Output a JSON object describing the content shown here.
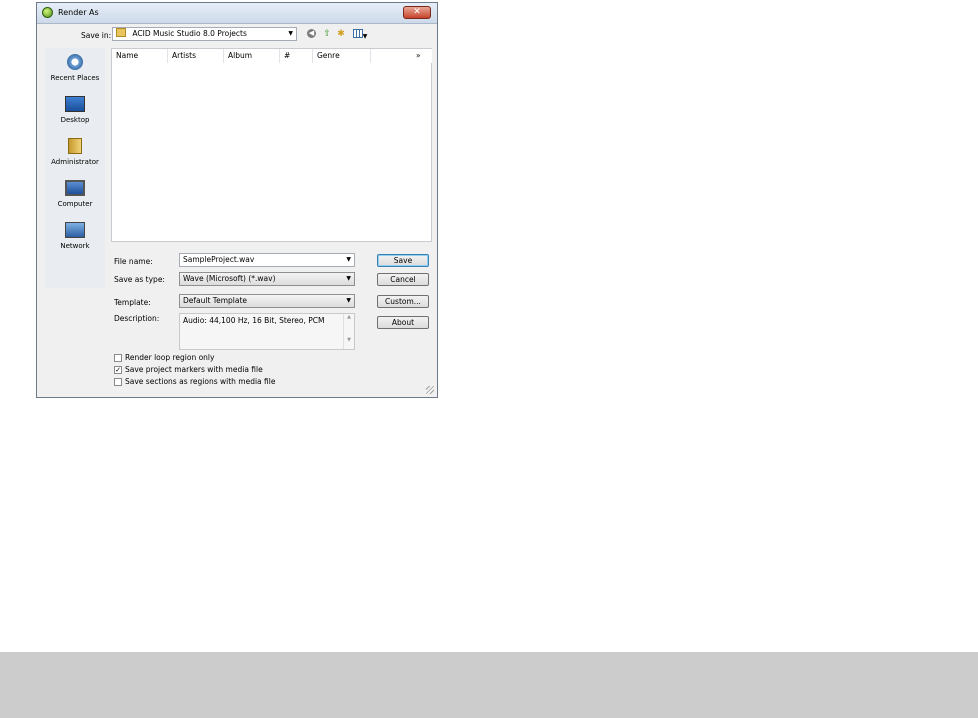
{
  "window": {
    "title": "Render As",
    "close_label": "✕"
  },
  "toolbar": {
    "save_in_label": "Save in:",
    "save_in_value": "ACID Music Studio 8.0 Projects",
    "back_icon": "back-icon",
    "up_icon": "up-folder-icon",
    "new_folder_icon": "new-folder-icon",
    "views_icon": "views-menu-icon"
  },
  "places": [
    {
      "label": "Recent Places",
      "icon": "recent-places-icon"
    },
    {
      "label": "Desktop",
      "icon": "desktop-icon"
    },
    {
      "label": "Administrator",
      "icon": "user-folder-icon"
    },
    {
      "label": "Computer",
      "icon": "computer-icon"
    },
    {
      "label": "Network",
      "icon": "network-icon"
    }
  ],
  "file_list": {
    "columns": [
      "Name",
      "Artists",
      "Album",
      "#",
      "Genre"
    ],
    "more": "»",
    "items": []
  },
  "form": {
    "file_name_label": "File name:",
    "file_name_value": "SampleProject.wav",
    "save_as_type_label": "Save as type:",
    "save_as_type_value": "Wave (Microsoft) (*.wav)",
    "template_label": "Template:",
    "template_value": "Default Template",
    "description_label": "Description:",
    "description_value": "Audio: 44,100 Hz, 16 Bit, Stereo, PCM"
  },
  "buttons": {
    "save": "Save",
    "cancel": "Cancel",
    "custom": "Custom...",
    "about": "About"
  },
  "options": [
    {
      "label": "Render loop region only",
      "checked": false
    },
    {
      "label": "Save project markers with media file",
      "checked": true
    },
    {
      "label": "Save sections as regions with media file",
      "checked": false
    }
  ]
}
